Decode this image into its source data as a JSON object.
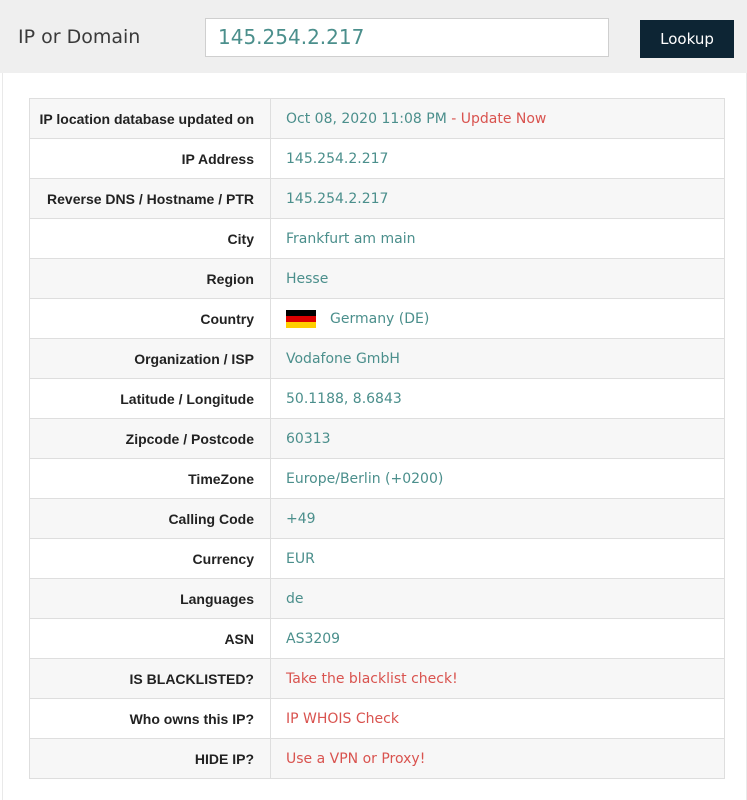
{
  "search": {
    "label": "IP or Domain",
    "value": "145.254.2.217",
    "button": "Lookup"
  },
  "rows": {
    "updated": {
      "key": "IP location database updated on",
      "value": "Oct 08, 2020 11:08 PM",
      "sep": " - ",
      "link": "Update Now"
    },
    "ip": {
      "key": "IP Address",
      "value": "145.254.2.217"
    },
    "rdns": {
      "key": "Reverse DNS / Hostname / PTR",
      "value": "145.254.2.217"
    },
    "city": {
      "key": "City",
      "value": "Frankfurt am main"
    },
    "region": {
      "key": "Region",
      "value": "Hesse"
    },
    "country": {
      "key": "Country",
      "value": "Germany (DE)"
    },
    "org": {
      "key": "Organization / ISP",
      "value": "Vodafone GmbH"
    },
    "latlon": {
      "key": "Latitude / Longitude",
      "value": "50.1188, 8.6843"
    },
    "zip": {
      "key": "Zipcode / Postcode",
      "value": "60313"
    },
    "tz": {
      "key": "TimeZone",
      "value": "Europe/Berlin (+0200)"
    },
    "calling": {
      "key": "Calling Code",
      "value": "+49"
    },
    "currency": {
      "key": "Currency",
      "value": "EUR"
    },
    "languages": {
      "key": "Languages",
      "value": "de"
    },
    "asn": {
      "key": "ASN",
      "value": "AS3209"
    },
    "blacklisted": {
      "key": "IS BLACKLISTED?",
      "link": "Take the blacklist check!"
    },
    "whois": {
      "key": "Who owns this IP?",
      "link": "IP WHOIS Check"
    },
    "hide": {
      "key": "HIDE IP?",
      "link": "Use a VPN or Proxy!"
    }
  },
  "colors": {
    "value_text": "#4b8f8c",
    "link_red": "#d9534f",
    "button_bg": "#0d2534",
    "flag": [
      "#000000",
      "#dd0000",
      "#ffce00"
    ]
  }
}
